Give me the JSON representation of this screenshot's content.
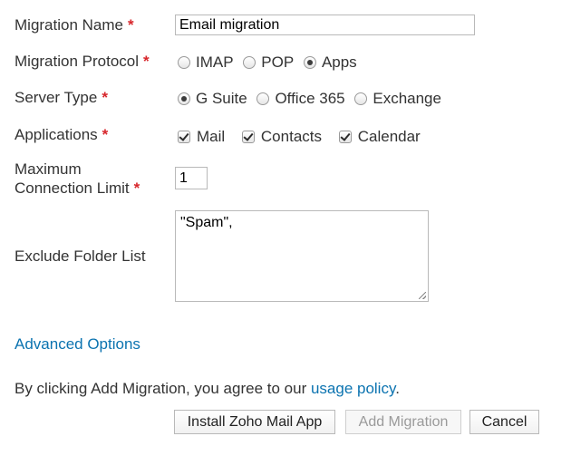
{
  "form": {
    "migration_name": {
      "label": "Migration Name",
      "required_mark": "*",
      "value": "Email migration"
    },
    "migration_protocol": {
      "label": "Migration Protocol",
      "required_mark": "*",
      "options": [
        {
          "label": "IMAP",
          "selected": false
        },
        {
          "label": "POP",
          "selected": false
        },
        {
          "label": "Apps",
          "selected": true
        }
      ]
    },
    "server_type": {
      "label": "Server Type",
      "required_mark": "*",
      "options": [
        {
          "label": "G Suite",
          "selected": true
        },
        {
          "label": "Office 365",
          "selected": false
        },
        {
          "label": "Exchange",
          "selected": false
        }
      ]
    },
    "applications": {
      "label": "Applications",
      "required_mark": "*",
      "options": [
        {
          "label": "Mail",
          "checked": true
        },
        {
          "label": "Contacts",
          "checked": true
        },
        {
          "label": "Calendar",
          "checked": true
        }
      ]
    },
    "max_connection_limit": {
      "label_line1": "Maximum",
      "label_line2": "Connection Limit",
      "required_mark": "*",
      "value": "1"
    },
    "exclude_folder_list": {
      "label": "Exclude Folder List",
      "value": "\"Spam\","
    }
  },
  "advanced_options": {
    "label": "Advanced Options"
  },
  "agreement": {
    "prefix": "By clicking Add Migration, you agree to our ",
    "link": "usage policy",
    "suffix": "."
  },
  "buttons": {
    "install": "Install Zoho Mail App",
    "add_migration": "Add Migration",
    "cancel": "Cancel"
  },
  "colors": {
    "text": "#333333",
    "required": "#d7262b",
    "link": "#0b73b0",
    "border": "#b9b9b9"
  }
}
